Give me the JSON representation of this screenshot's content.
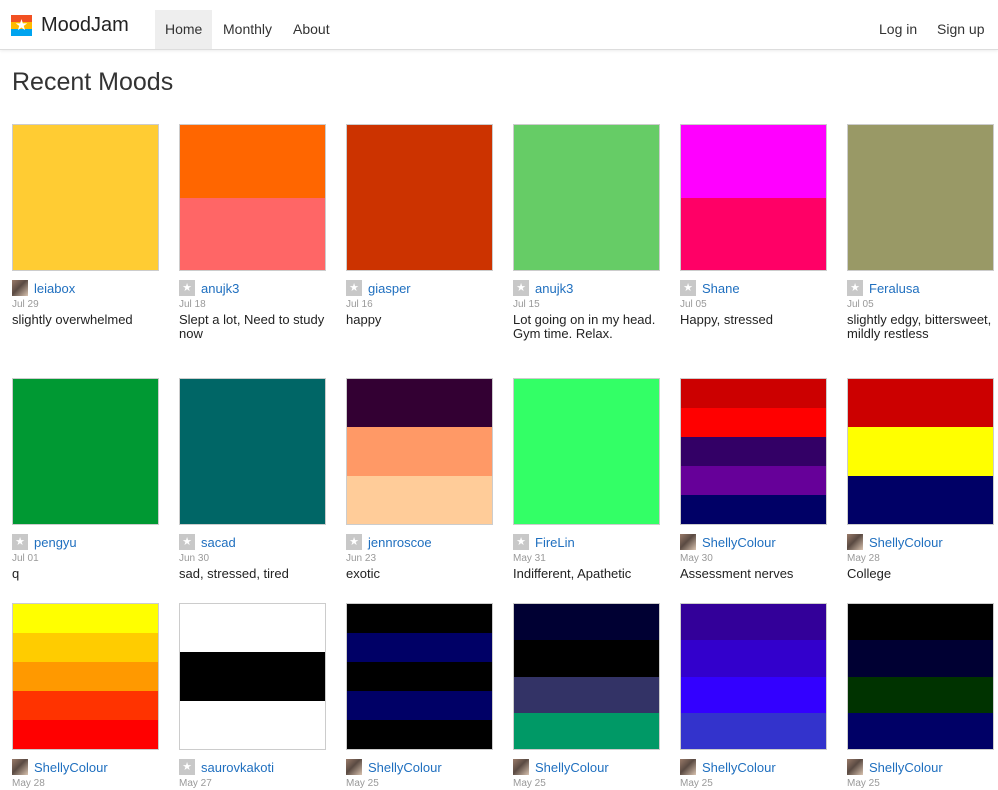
{
  "brand": {
    "name": "MoodJam",
    "logo_icon": "star-icon"
  },
  "nav": {
    "left": [
      {
        "label": "Home",
        "active": true
      },
      {
        "label": "Monthly",
        "active": false
      },
      {
        "label": "About",
        "active": false
      }
    ],
    "right": [
      {
        "label": "Log in"
      },
      {
        "label": "Sign up"
      }
    ]
  },
  "page": {
    "title": "Recent Moods"
  },
  "moods": [
    {
      "user": "leiabox",
      "avatar": "photo",
      "date": "Jul 29",
      "text": "slightly overwhelmed",
      "colors": [
        "#ffcc33"
      ]
    },
    {
      "user": "anujk3",
      "avatar": "default",
      "date": "Jul 18",
      "text": "Slept a lot, Need to study now",
      "colors": [
        "#ff6600",
        "#ff6666"
      ]
    },
    {
      "user": "giasper",
      "avatar": "default",
      "date": "Jul 16",
      "text": "happy",
      "colors": [
        "#cc3300"
      ]
    },
    {
      "user": "anujk3",
      "avatar": "default",
      "date": "Jul 15",
      "text": "Lot going on in my head. Gym time. Relax.",
      "colors": [
        "#66cc66"
      ]
    },
    {
      "user": "Shane",
      "avatar": "default",
      "date": "Jul 05",
      "text": "Happy, stressed",
      "colors": [
        "#ff00ff",
        "#ff0066"
      ]
    },
    {
      "user": "Feralusa",
      "avatar": "default",
      "date": "Jul 05",
      "text": "slightly edgy, bittersweet, mildly restless",
      "colors": [
        "#999966"
      ]
    },
    {
      "user": "pengyu",
      "avatar": "default",
      "date": "Jul 01",
      "text": "q",
      "colors": [
        "#009933"
      ]
    },
    {
      "user": "sacad",
      "avatar": "default",
      "date": "Jun 30",
      "text": "sad, stressed, tired",
      "colors": [
        "#006666"
      ]
    },
    {
      "user": "jennroscoe",
      "avatar": "default",
      "date": "Jun 23",
      "text": "exotic",
      "colors": [
        "#330033",
        "#ff9966",
        "#ffcc99"
      ]
    },
    {
      "user": "FireLin",
      "avatar": "default",
      "date": "May 31",
      "text": "Indifferent, Apathetic",
      "colors": [
        "#33ff66"
      ]
    },
    {
      "user": "ShellyColour",
      "avatar": "photo",
      "date": "May 30",
      "text": "Assessment nerves",
      "colors": [
        "#cc0000",
        "#ff0000",
        "#330066",
        "#660099",
        "#000066"
      ]
    },
    {
      "user": "ShellyColour",
      "avatar": "photo",
      "date": "May 28",
      "text": "College",
      "colors": [
        "#cc0000",
        "#ffff00",
        "#000066"
      ]
    },
    {
      "user": "ShellyColour",
      "avatar": "photo",
      "date": "May 28",
      "text": "",
      "colors": [
        "#ffff00",
        "#ffcc00",
        "#ff9900",
        "#ff3300",
        "#ff0000"
      ]
    },
    {
      "user": "saurovkakoti",
      "avatar": "default",
      "date": "May 27",
      "text": "",
      "colors": [
        "#ffffff",
        "#000000",
        "#ffffff"
      ]
    },
    {
      "user": "ShellyColour",
      "avatar": "photo",
      "date": "May 25",
      "text": "",
      "colors": [
        "#000000",
        "#000066",
        "#000000",
        "#000066",
        "#000000"
      ]
    },
    {
      "user": "ShellyColour",
      "avatar": "photo",
      "date": "May 25",
      "text": "",
      "colors": [
        "#000033",
        "#000000",
        "#333366",
        "#009966"
      ]
    },
    {
      "user": "ShellyColour",
      "avatar": "photo",
      "date": "May 25",
      "text": "",
      "colors": [
        "#330099",
        "#3300cc",
        "#3300ff",
        "#3333cc"
      ]
    },
    {
      "user": "ShellyColour",
      "avatar": "photo",
      "date": "May 25",
      "text": "",
      "colors": [
        "#000000",
        "#000033",
        "#003300",
        "#000066"
      ]
    }
  ]
}
